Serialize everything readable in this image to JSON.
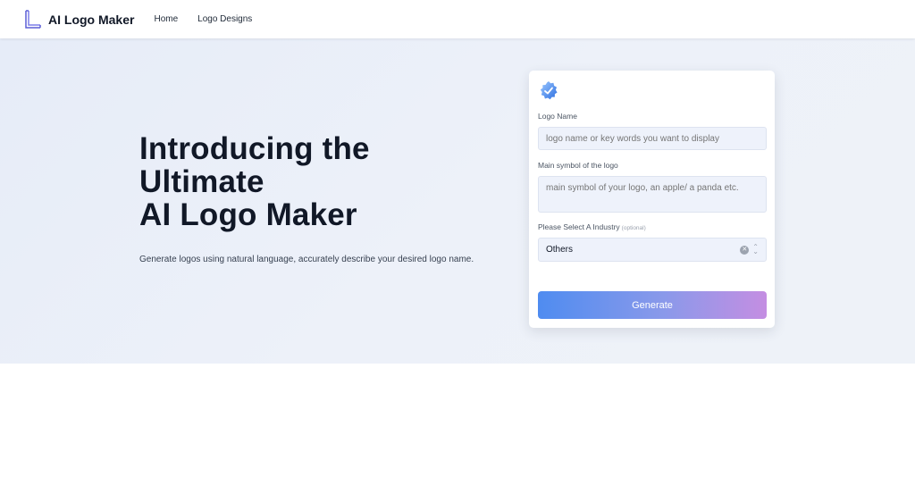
{
  "brand": {
    "name": "AI Logo Maker",
    "icon": "logo-l-icon"
  },
  "nav": {
    "items": [
      {
        "label": "Home"
      },
      {
        "label": "Logo Designs"
      }
    ]
  },
  "hero": {
    "title_lines": [
      "Introducing the",
      "Ultimate",
      "AI Logo Maker"
    ],
    "subtitle": "Generate logos using natural language, accurately describe your desired logo name."
  },
  "form": {
    "icon": "gear-badge-icon",
    "logo_name": {
      "label": "Logo Name",
      "placeholder": "logo name or key words you want to display",
      "value": ""
    },
    "main_symbol": {
      "label": "Main symbol of the logo",
      "placeholder": "main symbol of your logo, an apple/ a panda etc.",
      "value": ""
    },
    "industry": {
      "label": "Please Select A Industry",
      "optional": "(optional)",
      "selected": "Others"
    },
    "generate_label": "Generate"
  },
  "colors": {
    "accent_start": "#4f8cf0",
    "accent_end": "#c48ee2",
    "hero_bg": "#eaeff8"
  }
}
